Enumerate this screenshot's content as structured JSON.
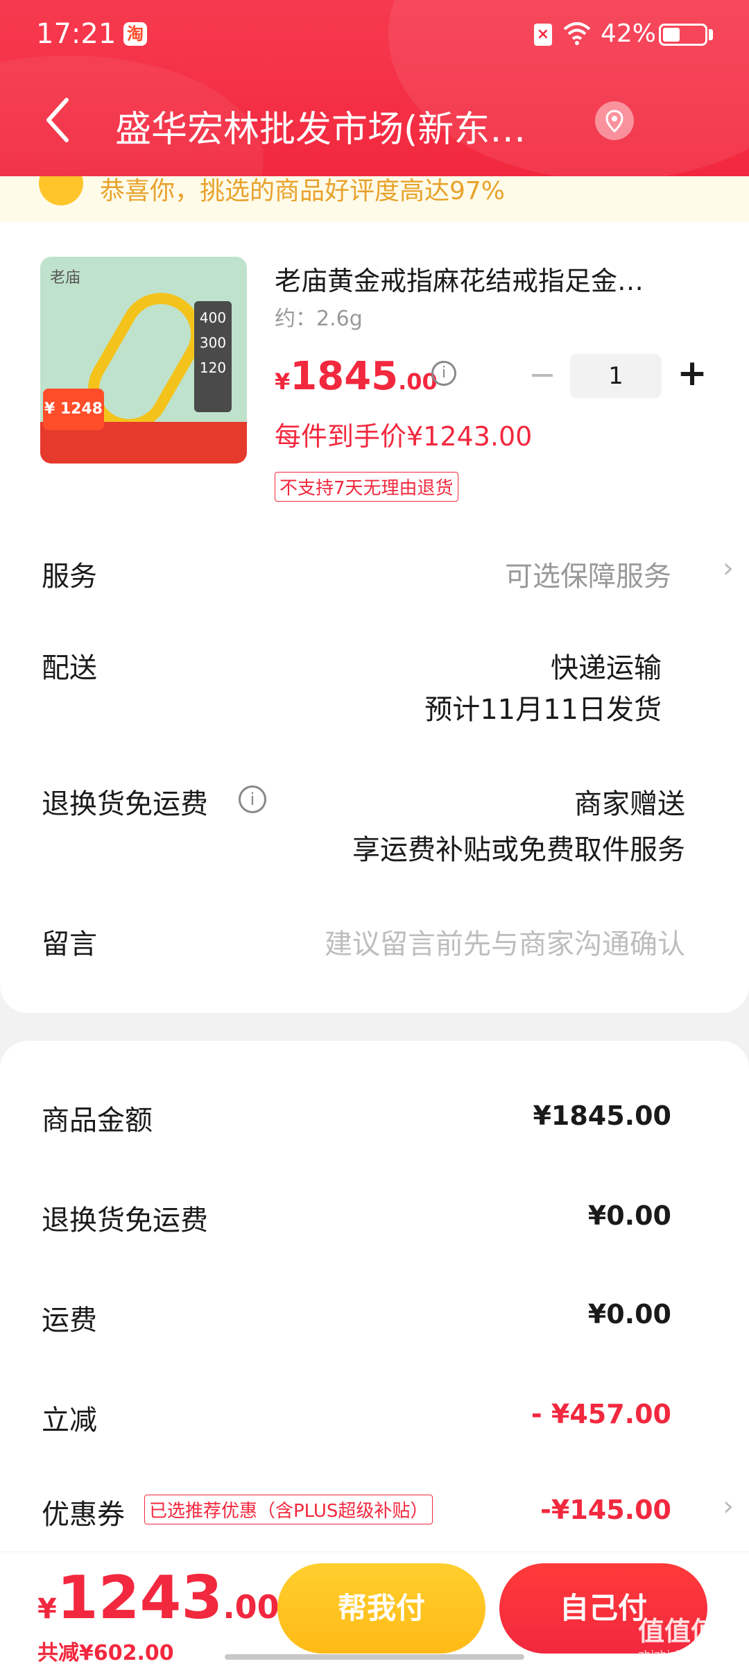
{
  "status_bar": {
    "time": "17:21",
    "app_badge": "淘",
    "battery": "42%",
    "battery_level": 0.42
  },
  "header": {
    "title": "盛华宏林批发市场(新东…"
  },
  "banner": {
    "text": "恭喜你，挑选的商品好评度高达97%"
  },
  "product": {
    "image_logo": "老庙",
    "image_price": "¥ 1248",
    "image_tags": [
      "400",
      "300",
      "120"
    ],
    "name": "老庙黄金戒指麻花结戒指足金…",
    "weight": "约：2.6g",
    "price_symbol": "¥",
    "price_int": "1845",
    "price_dec": ".00",
    "quantity": "1",
    "unit_price": "每件到手价¥1243.00",
    "no_return_tag": "不支持7天无理由退货"
  },
  "rows": {
    "service": {
      "label": "服务",
      "value": "可选保障服务"
    },
    "delivery": {
      "label": "配送",
      "value": "快递运输",
      "sub": "预计11月11日发货"
    },
    "return_shipping": {
      "label": "退换货免运费",
      "value": "商家赠送",
      "sub": "享运费补贴或免费取件服务"
    },
    "note": {
      "label": "留言",
      "placeholder": "建议留言前先与商家沟通确认"
    }
  },
  "summary": {
    "goods_amount": {
      "label": "商品金额",
      "value": "¥1845.00"
    },
    "return_fee": {
      "label": "退换货免运费",
      "value": "¥0.00"
    },
    "shipping": {
      "label": "运费",
      "value": "¥0.00"
    },
    "instant_discount": {
      "label": "立减",
      "value": "- ¥457.00"
    },
    "coupon": {
      "label": "优惠券",
      "tag": "已选推荐优惠（含PLUS超级补贴）",
      "value": "-¥145.00"
    }
  },
  "bottom": {
    "total_symbol": "¥",
    "total_int": "1243",
    "total_dec": ".00",
    "saved": "共减¥602.00",
    "help_pay": "帮我付",
    "self_pay": "自己付"
  },
  "watermark": {
    "text": "值值值",
    "sub": "zhizhizhi.com"
  },
  "colors": {
    "brand_red": "#f2283e",
    "help_yellow": "#ffc52b"
  }
}
